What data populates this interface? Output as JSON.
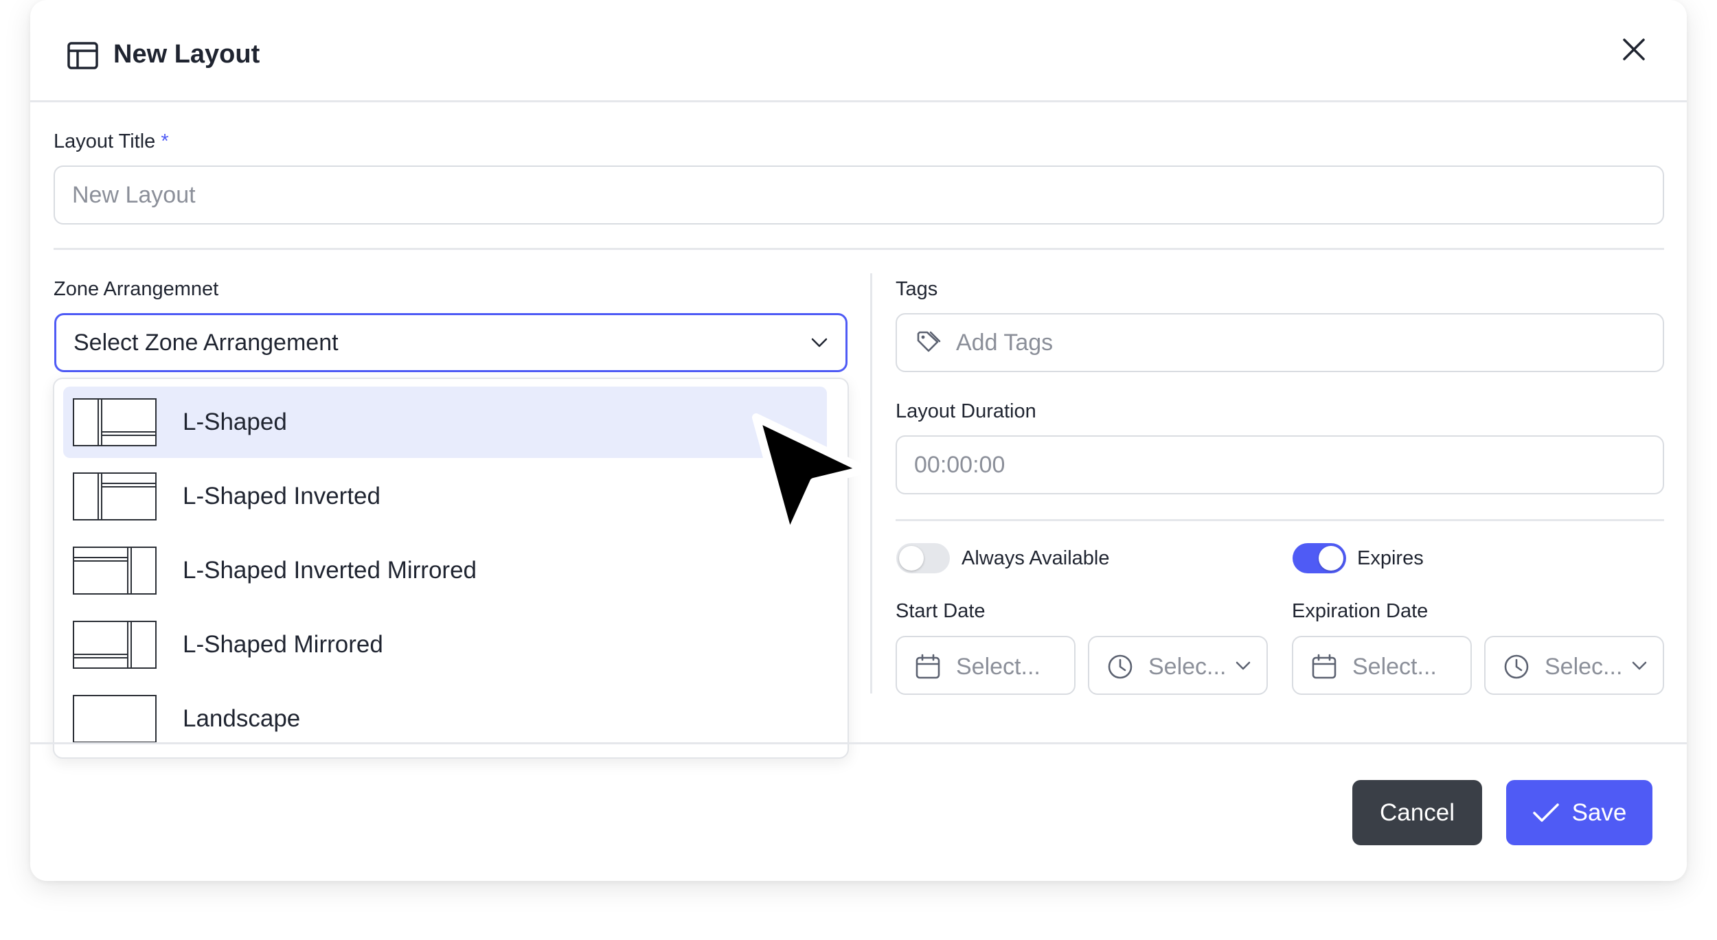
{
  "header": {
    "title": "New Layout",
    "title_icon": "layout-icon",
    "close_icon": "close-icon"
  },
  "layout_title": {
    "label": "Layout Title",
    "required_mark": "*",
    "placeholder": "New Layout"
  },
  "zone": {
    "label": "Zone Arrangemnet",
    "selected_text": "Select Zone Arrangement",
    "options": [
      {
        "label": "L-Shaped",
        "icon": "l-shaped-icon",
        "highlighted": true
      },
      {
        "label": "L-Shaped Inverted",
        "icon": "l-shaped-inverted-icon",
        "highlighted": false
      },
      {
        "label": "L-Shaped Inverted Mirrored",
        "icon": "l-shaped-inverted-mirrored-icon",
        "highlighted": false
      },
      {
        "label": "L-Shaped Mirrored",
        "icon": "l-shaped-mirrored-icon",
        "highlighted": false
      },
      {
        "label": "Landscape",
        "icon": "landscape-icon",
        "highlighted": false
      }
    ]
  },
  "tags": {
    "label": "Tags",
    "placeholder": "Add Tags",
    "icon": "tag-icon"
  },
  "duration": {
    "label": "Layout Duration",
    "placeholder": "00:00:00"
  },
  "availability": {
    "always_available_label": "Always Available",
    "always_available_on": false,
    "expires_label": "Expires",
    "expires_on": true
  },
  "start_date": {
    "label": "Start Date",
    "date_placeholder": "Select...",
    "time_placeholder": "Selec..."
  },
  "expiration_date": {
    "label": "Expiration Date",
    "date_placeholder": "Select...",
    "time_placeholder": "Selec..."
  },
  "actions": {
    "cancel_label": "Cancel",
    "save_label": "Save"
  },
  "colors": {
    "accent": "#4f5bf5",
    "cancel": "#3a3f47",
    "highlight": "#e8ecfc"
  }
}
